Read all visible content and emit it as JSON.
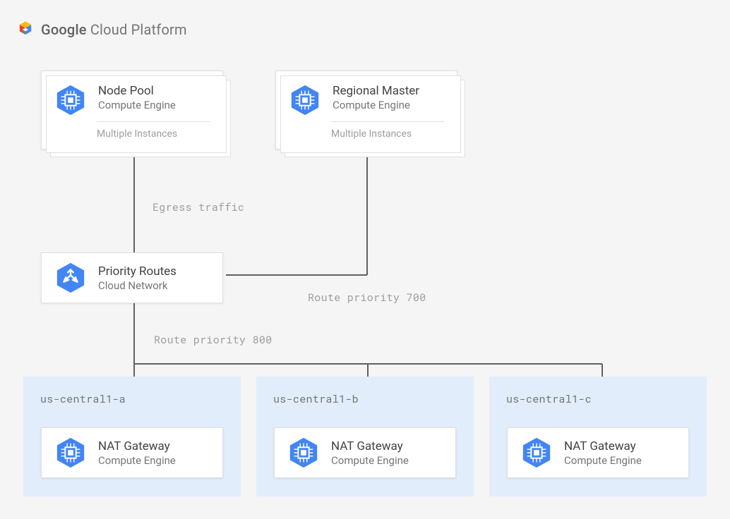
{
  "header": {
    "bold": "Google",
    "rest": " Cloud Platform"
  },
  "cards": {
    "nodePool": {
      "title": "Node Pool",
      "subtitle": "Compute Engine",
      "footer": "Multiple Instances"
    },
    "regionalMaster": {
      "title": "Regional Master",
      "subtitle": "Compute Engine",
      "footer": "Multiple Instances"
    },
    "priorityRoutes": {
      "title": "Priority Routes",
      "subtitle": "Cloud Network"
    },
    "natA": {
      "title": "NAT Gateway",
      "subtitle": "Compute Engine"
    },
    "natB": {
      "title": "NAT Gateway",
      "subtitle": "Compute Engine"
    },
    "natC": {
      "title": "NAT Gateway",
      "subtitle": "Compute Engine"
    }
  },
  "zones": {
    "a": "us-central1-a",
    "b": "us-central1-b",
    "c": "us-central1-c"
  },
  "labels": {
    "egress": "Egress traffic",
    "rp700": "Route priority 700",
    "rp800": "Route priority 800"
  }
}
